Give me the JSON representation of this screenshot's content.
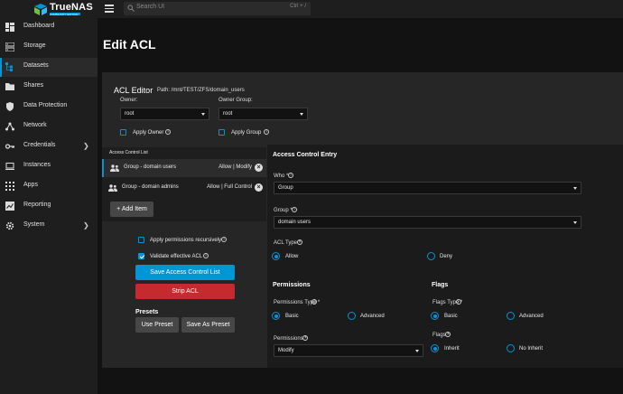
{
  "app": {
    "logo_text": "TrueNAS",
    "logo_sub": "COMMUNITY EDITION"
  },
  "search": {
    "placeholder": "Search UI",
    "shortcut": "Ctrl + /"
  },
  "sidebar": {
    "items": [
      {
        "label": "Dashboard",
        "icon": "dashboard-icon"
      },
      {
        "label": "Storage",
        "icon": "storage-icon"
      },
      {
        "label": "Datasets",
        "icon": "datasets-icon",
        "active": true
      },
      {
        "label": "Shares",
        "icon": "shares-icon"
      },
      {
        "label": "Data Protection",
        "icon": "shield-icon"
      },
      {
        "label": "Network",
        "icon": "network-icon"
      },
      {
        "label": "Credentials",
        "icon": "key-icon"
      },
      {
        "label": "Instances",
        "icon": "laptop-icon"
      },
      {
        "label": "Apps",
        "icon": "apps-icon"
      },
      {
        "label": "Reporting",
        "icon": "chart-icon"
      },
      {
        "label": "System",
        "icon": "gear-icon"
      }
    ]
  },
  "page": {
    "title": "Edit ACL"
  },
  "editor": {
    "title": "ACL Editor",
    "path": "Path: /mnt/TEST/ZFS/domain_users",
    "owner_label": "Owner:",
    "owner_value": "root",
    "owner_group_label": "Owner Group:",
    "owner_group_value": "root",
    "apply_owner": "Apply Owner",
    "apply_group": "Apply Group"
  },
  "acl_list": {
    "title": "Access Control List",
    "items": [
      {
        "name": "Group - domain users",
        "perm": "Allow | Modify"
      },
      {
        "name": "Group - domain admins",
        "perm": "Allow | Full Control"
      }
    ],
    "add_item": "Add Item"
  },
  "actions": {
    "apply_recursive": "Apply permissions recursively",
    "validate": "Validate effective ACL",
    "save": "Save Access Control List",
    "strip": "Strip ACL",
    "presets_title": "Presets",
    "use_preset": "Use Preset",
    "save_as_preset": "Save As Preset"
  },
  "entry": {
    "title": "Access Control Entry",
    "who_label": "Who *",
    "who_value": "Group",
    "group_label": "Group *",
    "group_value": "domain users",
    "acl_type_label": "ACL Type *",
    "allow": "Allow",
    "deny": "Deny",
    "permissions_title": "Permissions",
    "perm_type_label": "Permissions Type *",
    "basic": "Basic",
    "advanced": "Advanced",
    "permissions_label": "Permissions *",
    "permissions_value": "Modify",
    "flags_title": "Flags",
    "flags_type_label": "Flags Type *",
    "flags_basic": "Basic",
    "flags_advanced": "Advanced",
    "flags_label": "Flags *",
    "inherit": "Inherit",
    "no_inherit": "No Inherit"
  },
  "colors": {
    "accent": "#0095d5",
    "danger": "#c52a2f"
  }
}
